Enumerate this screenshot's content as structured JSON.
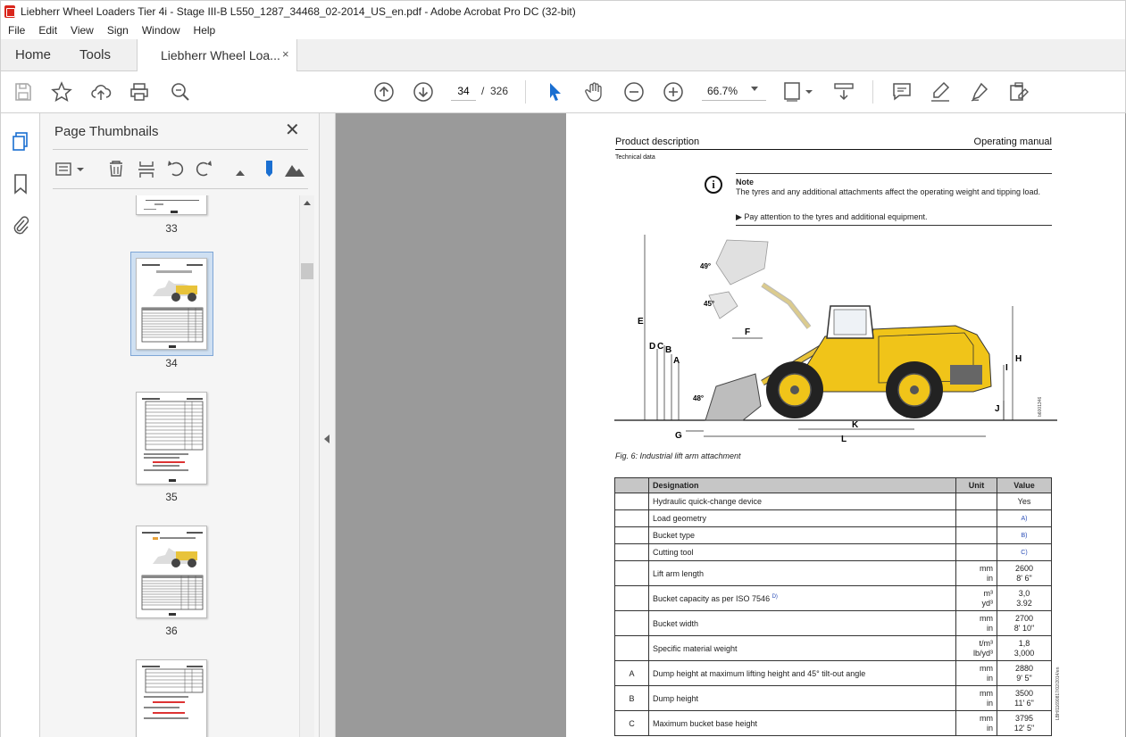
{
  "window": {
    "title": "Liebherr Wheel Loaders Tier 4i - Stage III-B L550_1287_34468_02-2014_US_en.pdf - Adobe Acrobat Pro DC (32-bit)"
  },
  "menu": [
    "File",
    "Edit",
    "View",
    "Sign",
    "Window",
    "Help"
  ],
  "tabs": {
    "home": "Home",
    "tools": "Tools",
    "document": "Liebherr Wheel Loa...",
    "close": "×"
  },
  "toolbar": {
    "page_current": "34",
    "page_sep": "/",
    "page_total": "326",
    "zoom": "66.7%"
  },
  "thumbnails": {
    "title": "Page Thumbnails",
    "close": "✕",
    "pages": [
      "33",
      "34",
      "35",
      "36"
    ]
  },
  "pdf": {
    "header_left": "Product description",
    "header_right": "Operating manual",
    "subheader": "Technical data",
    "note_title": "Note",
    "note_text": "The tyres and any additional attachments affect the operating weight and tipping load.",
    "note_bullet": "▶  Pay attention to the tyres and additional equipment.",
    "figure_caption": "Fig. 6: Industrial lift arm attachment",
    "figure_code": "b6001346",
    "side_code": "LBH/11690817/02/2014/en",
    "figure_labels": {
      "angle1": "49°",
      "angle2": "45°",
      "angle3": "48°",
      "E": "E",
      "D": "D",
      "C": "C",
      "B": "B",
      "A": "A",
      "F": "F",
      "H": "H",
      "I": "I",
      "J": "J",
      "K": "K",
      "L": "L",
      "G": "G"
    },
    "table": {
      "headers": [
        "",
        "Designation",
        "Unit",
        "Value"
      ],
      "rows": [
        {
          "sym": "",
          "des": "Hydraulic quick-change device",
          "unit": "",
          "val": "Yes"
        },
        {
          "sym": "",
          "des": "Load geometry",
          "unit": "",
          "val": "A)"
        },
        {
          "sym": "",
          "des": "Bucket type",
          "unit": "",
          "val": "B)"
        },
        {
          "sym": "",
          "des": "Cutting tool",
          "unit": "",
          "val": "C)"
        },
        {
          "sym": "",
          "des": "Lift arm length",
          "unit1": "mm",
          "unit2": "in",
          "val1": "2600",
          "val2": "8' 6\""
        },
        {
          "sym": "",
          "des": "Bucket capacity as per ISO 7546",
          "sup": "D)",
          "unit1": "m³",
          "unit2": "yd³",
          "val1": "3,0",
          "val2": "3.92"
        },
        {
          "sym": "",
          "des": "Bucket width",
          "unit1": "mm",
          "unit2": "in",
          "val1": "2700",
          "val2": "8' 10\""
        },
        {
          "sym": "",
          "des": "Specific material weight",
          "unit1": "t/m³",
          "unit2": "lb/yd³",
          "val1": "1,8",
          "val2": "3,000"
        },
        {
          "sym": "A",
          "des": "Dump height at maximum lifting height and 45° tilt-out angle",
          "unit1": "mm",
          "unit2": "in",
          "val1": "2880",
          "val2": "9' 5\""
        },
        {
          "sym": "B",
          "des": "Dump height",
          "unit1": "mm",
          "unit2": "in",
          "val1": "3500",
          "val2": "11' 6\""
        },
        {
          "sym": "C",
          "des": "Maximum bucket base height",
          "unit1": "mm",
          "unit2": "in",
          "val1": "3795",
          "val2": "12' 5\""
        }
      ]
    }
  }
}
